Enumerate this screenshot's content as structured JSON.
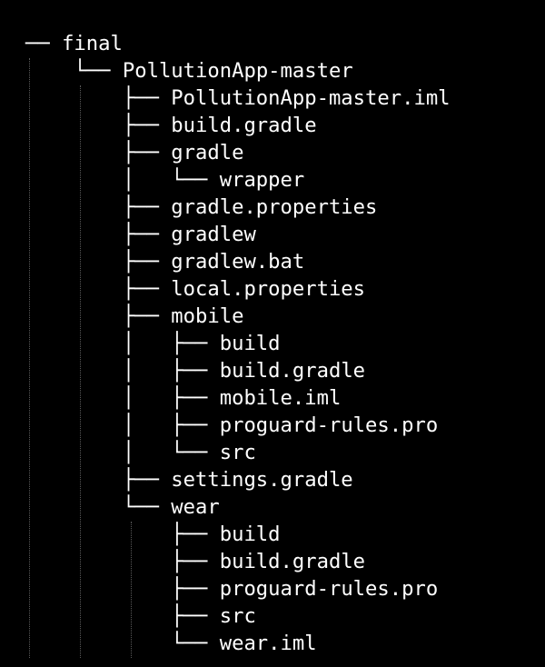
{
  "tree": {
    "lines": [
      {
        "branch": "── ",
        "name": "final",
        "depth": 0
      },
      {
        "branch": "    └── ",
        "name": "PollutionApp-master",
        "depth": 1
      },
      {
        "branch": "        ├── ",
        "name": "PollutionApp-master.iml",
        "depth": 2
      },
      {
        "branch": "        ├── ",
        "name": "build.gradle",
        "depth": 2
      },
      {
        "branch": "        ├── ",
        "name": "gradle",
        "depth": 2
      },
      {
        "branch": "        │   └── ",
        "name": "wrapper",
        "depth": 3
      },
      {
        "branch": "        ├── ",
        "name": "gradle.properties",
        "depth": 2
      },
      {
        "branch": "        ├── ",
        "name": "gradlew",
        "depth": 2
      },
      {
        "branch": "        ├── ",
        "name": "gradlew.bat",
        "depth": 2
      },
      {
        "branch": "        ├── ",
        "name": "local.properties",
        "depth": 2
      },
      {
        "branch": "        ├── ",
        "name": "mobile",
        "depth": 2
      },
      {
        "branch": "        │   ├── ",
        "name": "build",
        "depth": 3
      },
      {
        "branch": "        │   ├── ",
        "name": "build.gradle",
        "depth": 3
      },
      {
        "branch": "        │   ├── ",
        "name": "mobile.iml",
        "depth": 3
      },
      {
        "branch": "        │   ├── ",
        "name": "proguard-rules.pro",
        "depth": 3
      },
      {
        "branch": "        │   └── ",
        "name": "src",
        "depth": 3
      },
      {
        "branch": "        ├── ",
        "name": "settings.gradle",
        "depth": 2
      },
      {
        "branch": "        └── ",
        "name": "wear",
        "depth": 2
      },
      {
        "branch": "            ├── ",
        "name": "build",
        "depth": 3
      },
      {
        "branch": "            ├── ",
        "name": "build.gradle",
        "depth": 3
      },
      {
        "branch": "            ├── ",
        "name": "proguard-rules.pro",
        "depth": 3
      },
      {
        "branch": "            ├── ",
        "name": "src",
        "depth": 3
      },
      {
        "branch": "            └── ",
        "name": "wear.iml",
        "depth": 3
      }
    ]
  },
  "colors": {
    "background": "#000000",
    "text": "#ffffff",
    "indent_guide": "#5a5a5a"
  }
}
